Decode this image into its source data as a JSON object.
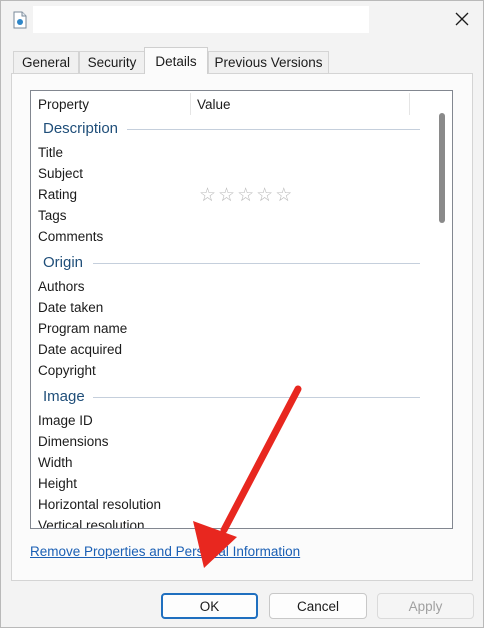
{
  "tabs": [
    {
      "label": "General"
    },
    {
      "label": "Security"
    },
    {
      "label": "Details"
    },
    {
      "label": "Previous Versions"
    }
  ],
  "columns": {
    "property": "Property",
    "value": "Value"
  },
  "groups": {
    "description": {
      "label": "Description",
      "props": [
        "Title",
        "Subject",
        "Rating",
        "Tags",
        "Comments"
      ]
    },
    "origin": {
      "label": "Origin",
      "props": [
        "Authors",
        "Date taken",
        "Program name",
        "Date acquired",
        "Copyright"
      ]
    },
    "image": {
      "label": "Image",
      "props": [
        "Image ID",
        "Dimensions",
        "Width",
        "Height",
        "Horizontal resolution",
        "Vertical resolution"
      ]
    }
  },
  "rating": {
    "stars": 5,
    "filled": 0
  },
  "remove_link": "Remove Properties and Personal Information",
  "buttons": {
    "ok": "OK",
    "cancel": "Cancel",
    "apply": "Apply"
  },
  "annotation": {
    "arrow_color": "#e8271f"
  },
  "icons": {
    "file": "file-icon",
    "close": "close-icon",
    "star": "star-icon"
  }
}
